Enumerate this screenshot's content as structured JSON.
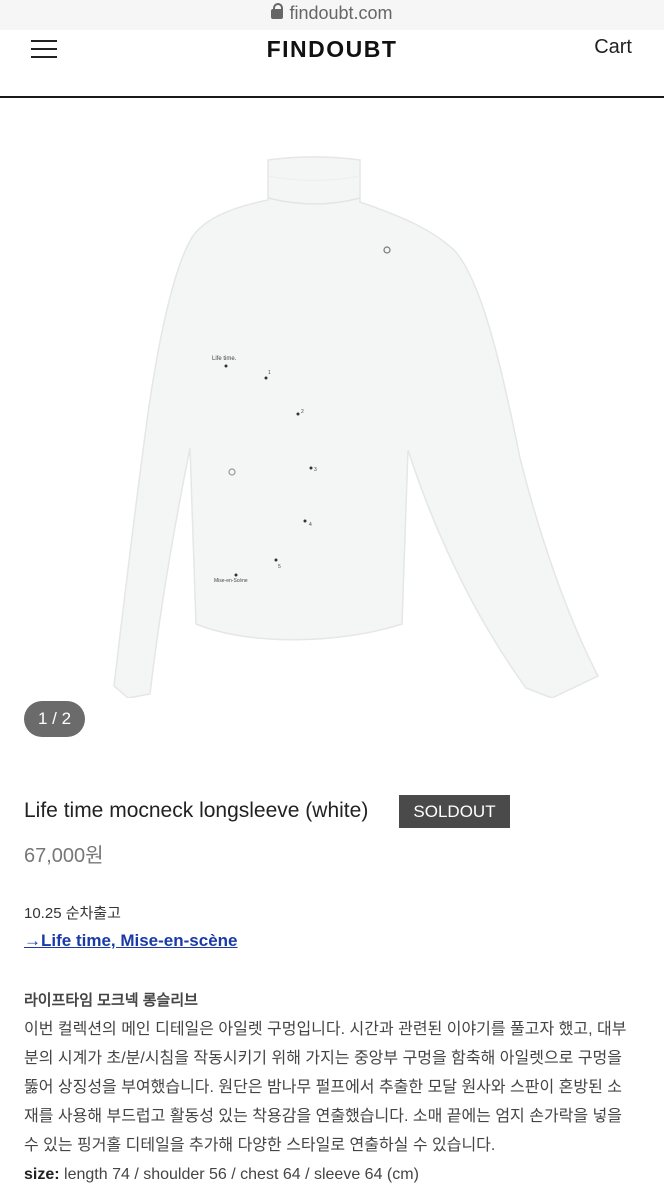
{
  "browser": {
    "url": "findoubt.com"
  },
  "header": {
    "logo": "FINDOUBT",
    "cart": "Cart"
  },
  "gallery": {
    "counter": "1 / 2",
    "print_text": {
      "life_time": "Life time.",
      "mise": "Mise-en-Scène",
      "n1": "1",
      "n2": "2",
      "n3": "3",
      "n4": "4",
      "n5": "5"
    }
  },
  "product": {
    "title": "Life time mocneck longsleeve (white)",
    "badge": "SOLDOUT",
    "price": "67,000원",
    "release": "10.25 순차출고",
    "collection_link": "→Life time, Mise-en-scène",
    "subtitle": "라이프타임 모크넥 롱슬리브",
    "description_lines": [
      "이번 컬렉션의 메인 디테일은 아일렛 구멍입니다. 시간과 관련된 이야기를 풀고자 했고, 대부",
      "분의 시계가 초/분/시침을 작동시키기 위해 가지는 중앙부 구멍을 함축해 아일렛으로 구멍을",
      "뚫어 상징성을 부여했습니다. 원단은 밤나무 펄프에서 추출한 모달 원사와 스판이 혼방된 소",
      "재를 사용해 부드럽고 활동성 있는 착용감을 연출했습니다. 소매 끝에는 엄지 손가락을 넣을",
      "수 있는 핑거홀 디테일을 추가해 다양한 스타일로 연출하실 수 있습니다."
    ],
    "size_label": "size:",
    "size_value": "length 74 / shoulder 56 / chest 64 / sleeve 64 (cm)"
  }
}
